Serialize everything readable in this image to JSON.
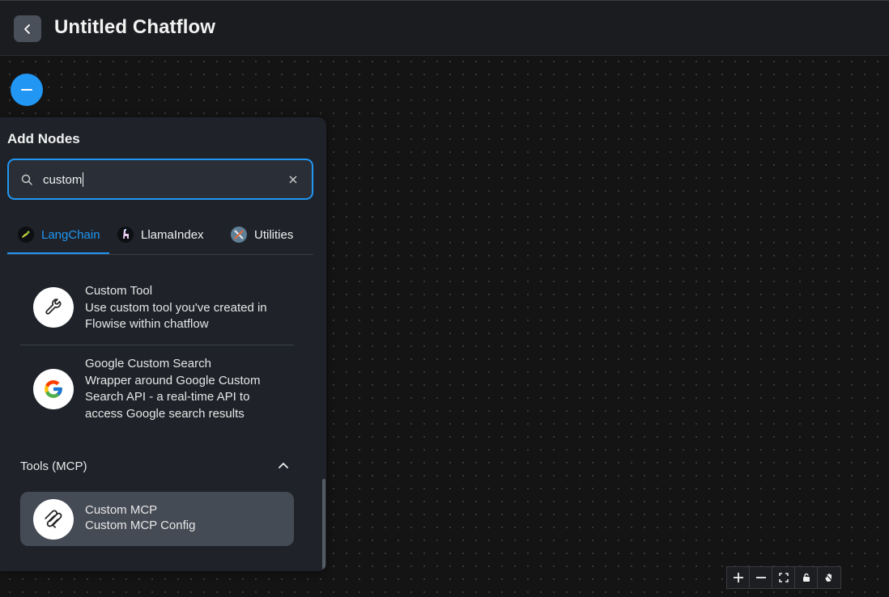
{
  "header": {
    "title": "Untitled Chatflow",
    "back_icon": "chevron-left-icon"
  },
  "fab": {
    "icon": "minus-icon",
    "color": "#2196f3"
  },
  "panel": {
    "title": "Add Nodes",
    "search": {
      "value": "custom",
      "placeholder": "Search nodes"
    },
    "tabs": [
      {
        "label": "LangChain",
        "icon": "langchain-icon",
        "active": true
      },
      {
        "label": "LlamaIndex",
        "icon": "llamaindex-icon",
        "active": false
      },
      {
        "label": "Utilities",
        "icon": "utilities-icon",
        "active": false
      }
    ],
    "nodes": [
      {
        "name": "Custom Tool",
        "desc": "Use custom tool you've created in Flowise within chatflow",
        "icon": "wrench-icon"
      },
      {
        "name": "Google Custom Search",
        "desc": "Wrapper around Google Custom Search API - a real-time API to access Google search results",
        "icon": "google-icon"
      }
    ],
    "section": {
      "label": "Tools (MCP)",
      "expanded": true
    },
    "mcp_nodes": [
      {
        "name": "Custom MCP",
        "desc": "Custom MCP Config",
        "icon": "mcp-icon"
      }
    ]
  },
  "canvas_controls": [
    "zoom-in-icon",
    "zoom-out-icon",
    "fit-view-icon",
    "lock-icon",
    "hand-icon"
  ],
  "colors": {
    "accent": "#2196f3",
    "panel_bg": "#1f2329",
    "canvas_bg": "#141414"
  }
}
